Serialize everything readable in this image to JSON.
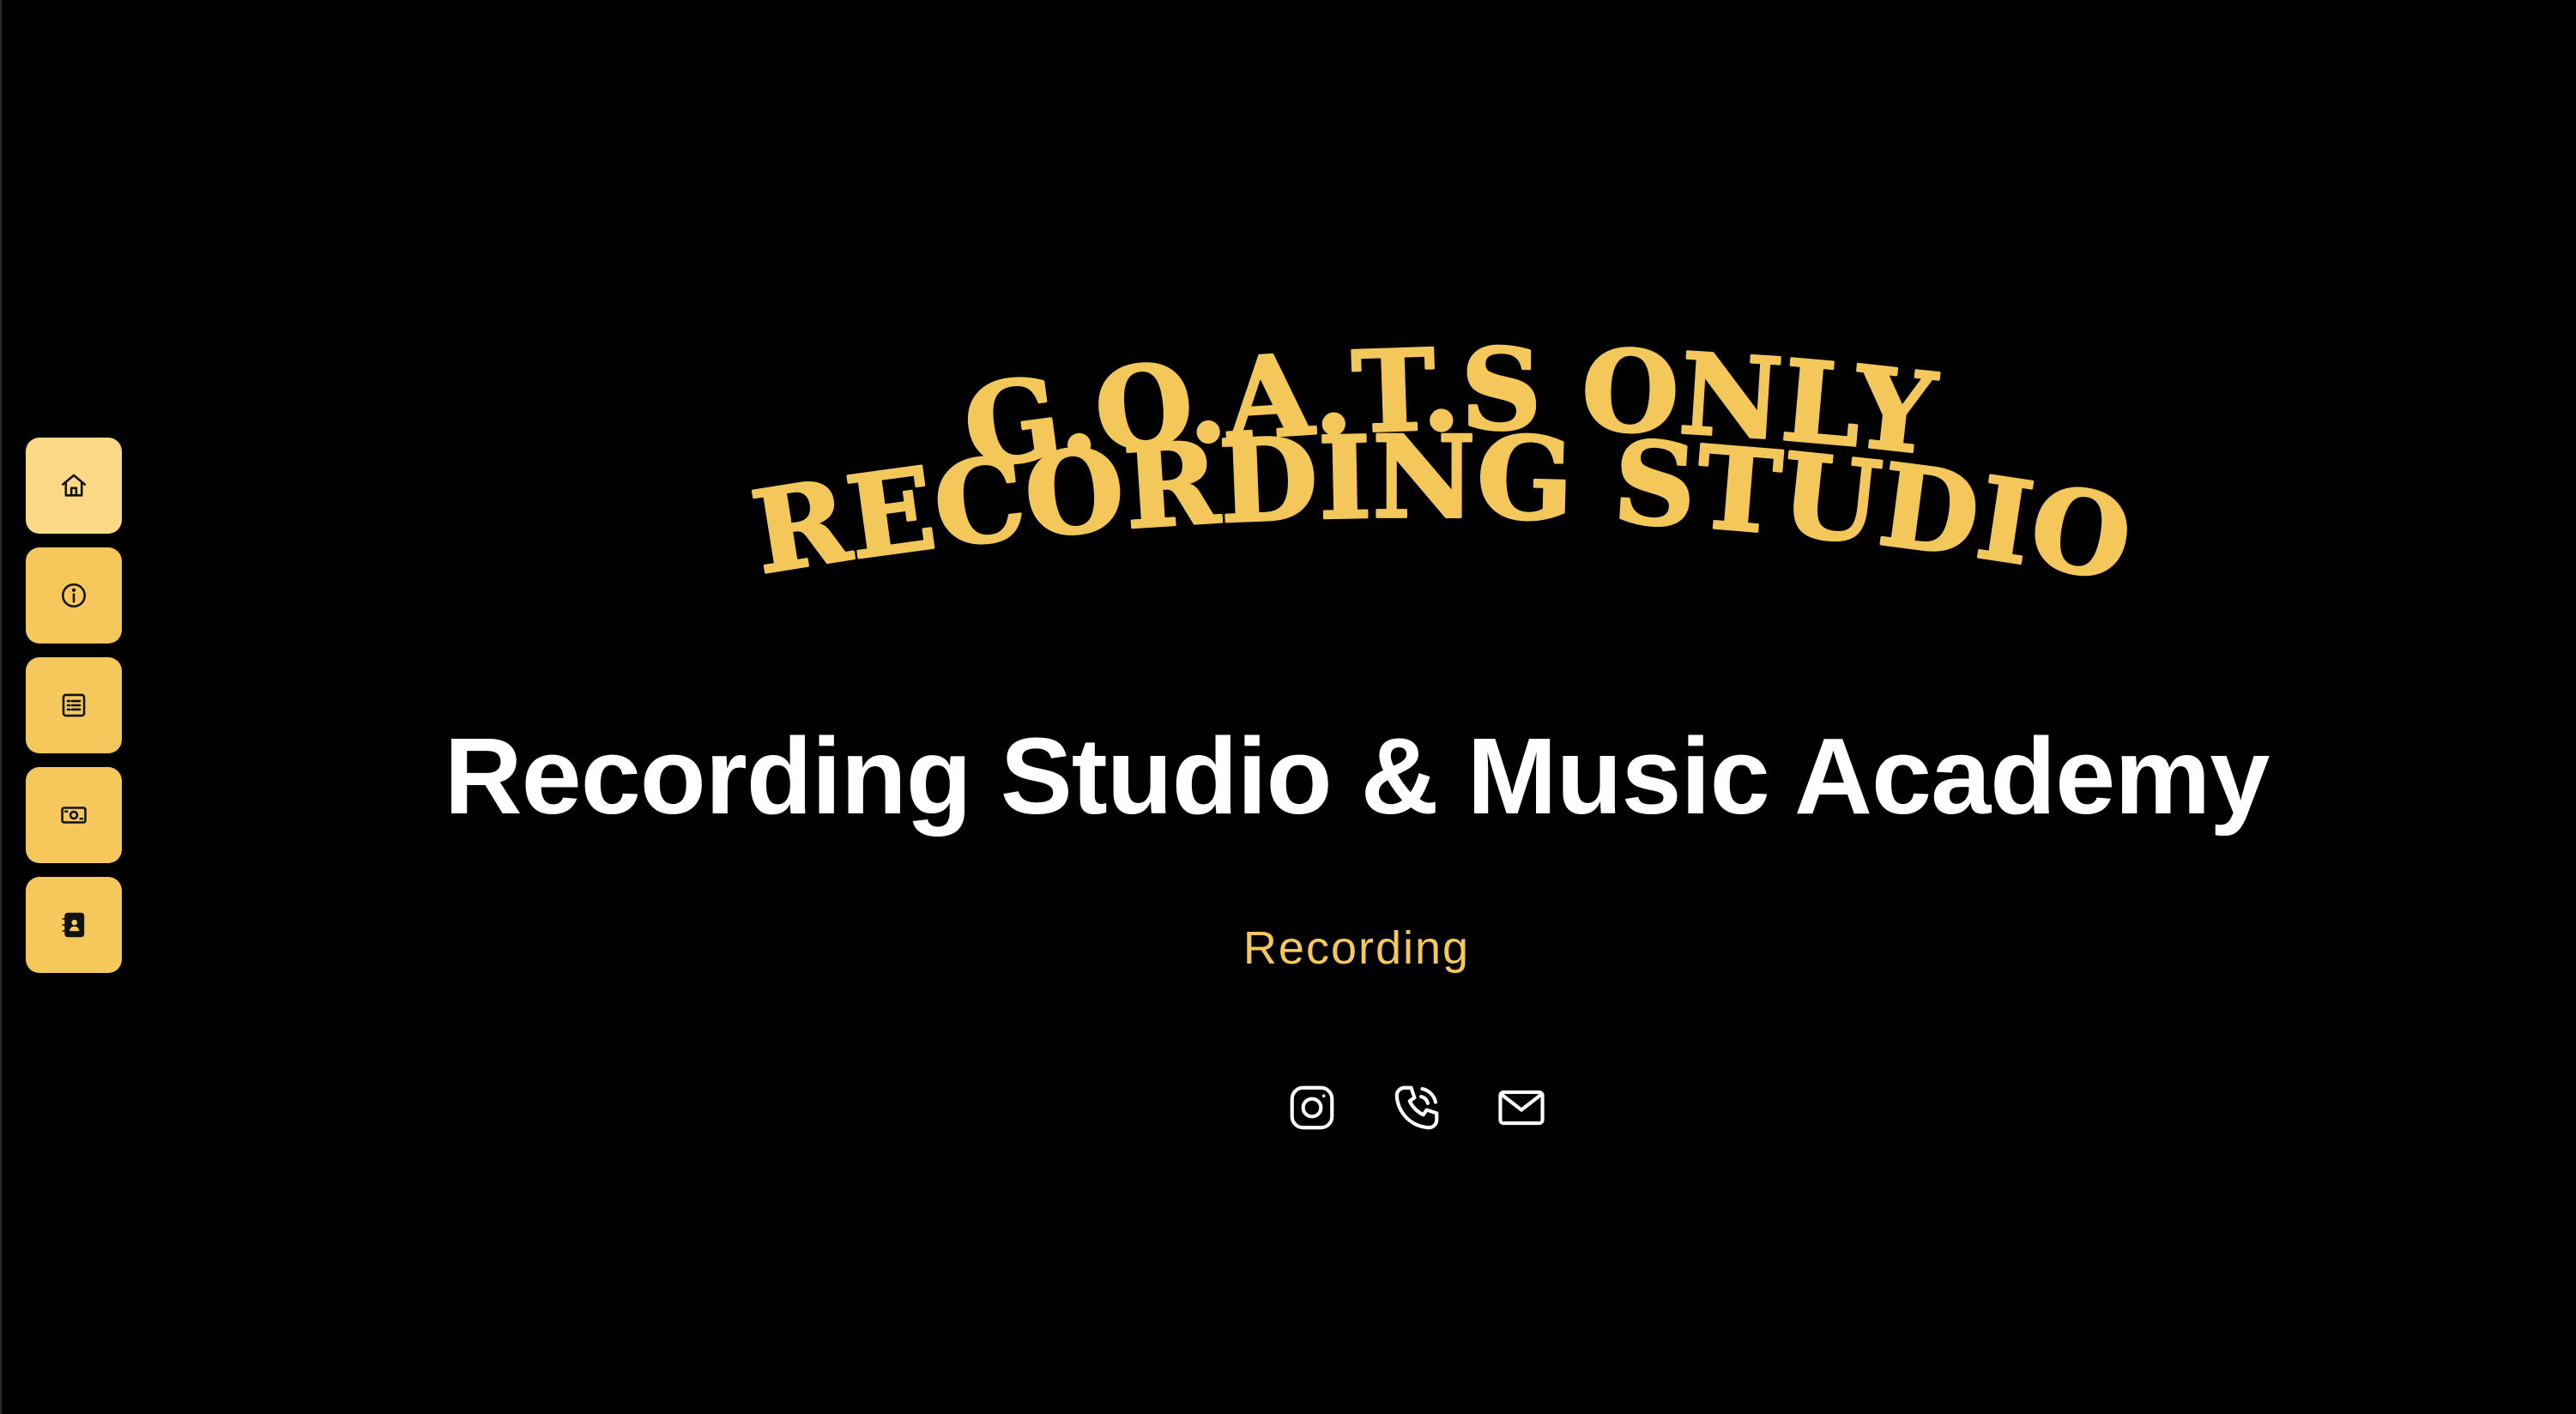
{
  "colors": {
    "background": "#000000",
    "accent": "#f6c85c",
    "accent_active": "#fad886",
    "headline": "#ffffff"
  },
  "sidebar": {
    "items": [
      {
        "icon": "home-icon",
        "label": "Home",
        "active": true
      },
      {
        "icon": "info-icon",
        "label": "About"
      },
      {
        "icon": "list-icon",
        "label": "Services"
      },
      {
        "icon": "money-icon",
        "label": "Pricing"
      },
      {
        "icon": "contact-book-icon",
        "label": "Contact"
      }
    ]
  },
  "hero": {
    "logo_line1": "G.O.A.T.S ONLY",
    "logo_line2": "RECORDING STUDIO",
    "headline": "Recording Studio & Music Academy",
    "typed_text": "Recording"
  },
  "social": [
    {
      "icon": "instagram-icon"
    },
    {
      "icon": "phone-icon"
    },
    {
      "icon": "mail-icon"
    }
  ]
}
